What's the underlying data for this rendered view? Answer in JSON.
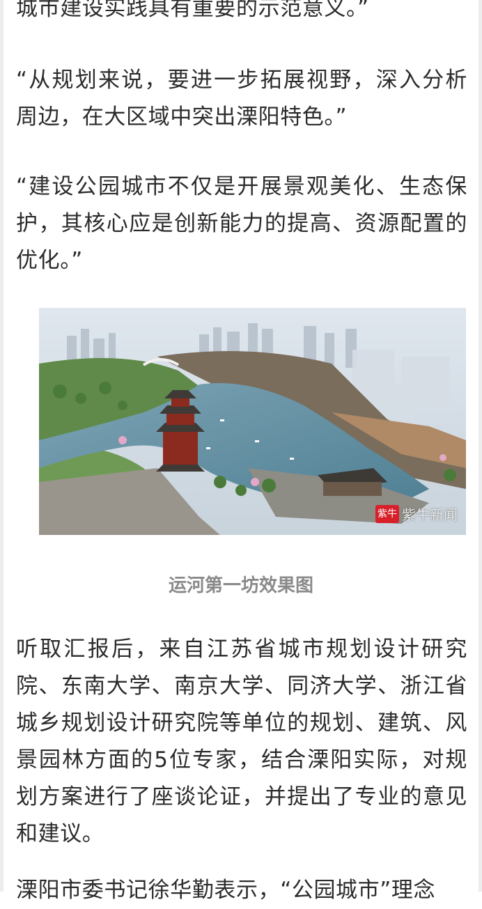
{
  "article": {
    "paragraphs": [
      "城市建设实践具有重要的示范意义。”",
      "“从规划来说，要进一步拓展视野，深入分析周边，在大区域中突出溧阳特色。”",
      "“建设公园城市不仅是开展景观美化、生态保护，其核心应是创新能力的提高、资源配置的优化。”",
      "听取汇报后，来自江苏省城市规划设计研究院、东南大学、南京大学、同济大学、浙江省城乡规划设计研究院等单位的规划、建筑、风景园林方面的5位专家，结合溧阳实际，对规划方案进行了座谈论证，并提出了专业的意见和建议。",
      "溧阳市委书记徐华勤表示，“公园城市”理念"
    ],
    "figure": {
      "caption": "运河第一坊效果图",
      "watermark_logo": "紫牛",
      "watermark_text": "紫牛新闻"
    }
  }
}
